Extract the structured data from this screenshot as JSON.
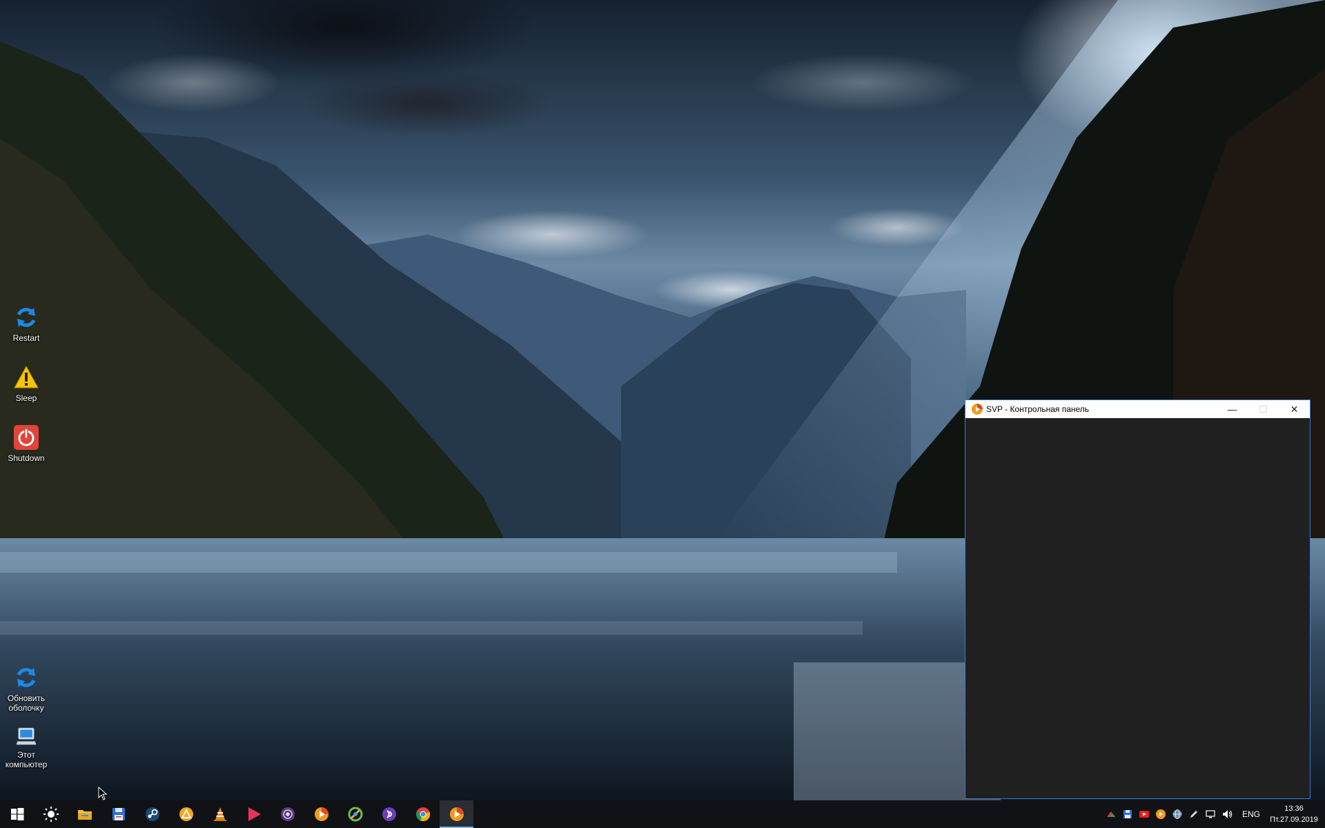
{
  "desktop": {
    "icons": [
      {
        "label": "Restart",
        "icon": "refresh-icon"
      },
      {
        "label": "Sleep",
        "icon": "warning-icon"
      },
      {
        "label": "Shutdown",
        "icon": "power-icon"
      },
      {
        "label": "Обновить\nоболочку",
        "icon": "refresh-icon"
      },
      {
        "label": "Этот\nкомпьютер",
        "icon": "computer-icon"
      }
    ]
  },
  "window": {
    "title": "SVP - Контрольная панель",
    "app_icon": "svp-icon",
    "minimize_symbol": "—",
    "maximize_symbol": "☐",
    "close_symbol": "✕"
  },
  "taskbar": {
    "pinned": [
      {
        "name": "start",
        "icon": "windows-logo-icon",
        "active": false
      },
      {
        "name": "brightness",
        "icon": "sun-icon",
        "active": false
      },
      {
        "name": "file-explorer",
        "icon": "folder-icon",
        "active": false
      },
      {
        "name": "save-app",
        "icon": "floppy-icon",
        "active": false
      },
      {
        "name": "steam",
        "icon": "steam-icon",
        "active": false
      },
      {
        "name": "aimp",
        "icon": "aimp-icon",
        "active": false
      },
      {
        "name": "vlc",
        "icon": "vlc-cone-icon",
        "active": false
      },
      {
        "name": "media-player",
        "icon": "play-icon",
        "active": false
      },
      {
        "name": "music-app",
        "icon": "disc-icon",
        "active": false
      },
      {
        "name": "svp-pinned",
        "icon": "svp-icon",
        "active": false
      },
      {
        "name": "torrent",
        "icon": "torrent-icon",
        "active": false
      },
      {
        "name": "podcast",
        "icon": "podcast-icon",
        "active": false
      },
      {
        "name": "chrome",
        "icon": "chrome-icon",
        "active": false
      },
      {
        "name": "svp-running",
        "icon": "svp-icon",
        "active": true
      }
    ],
    "tray": {
      "icons": [
        "chevron-up-icon",
        "floppy-icon",
        "youtube-icon",
        "svp-icon",
        "network-globe-icon",
        "pen-icon",
        "network-icon",
        "volume-icon"
      ],
      "language": "ENG",
      "time": "13:36",
      "date": "Пт.27.09.2019"
    }
  },
  "colors": {
    "taskbar_bg": "#101216",
    "window_bg": "#202020",
    "window_border": "#3a7bd5",
    "accent": "#76b9ed"
  }
}
